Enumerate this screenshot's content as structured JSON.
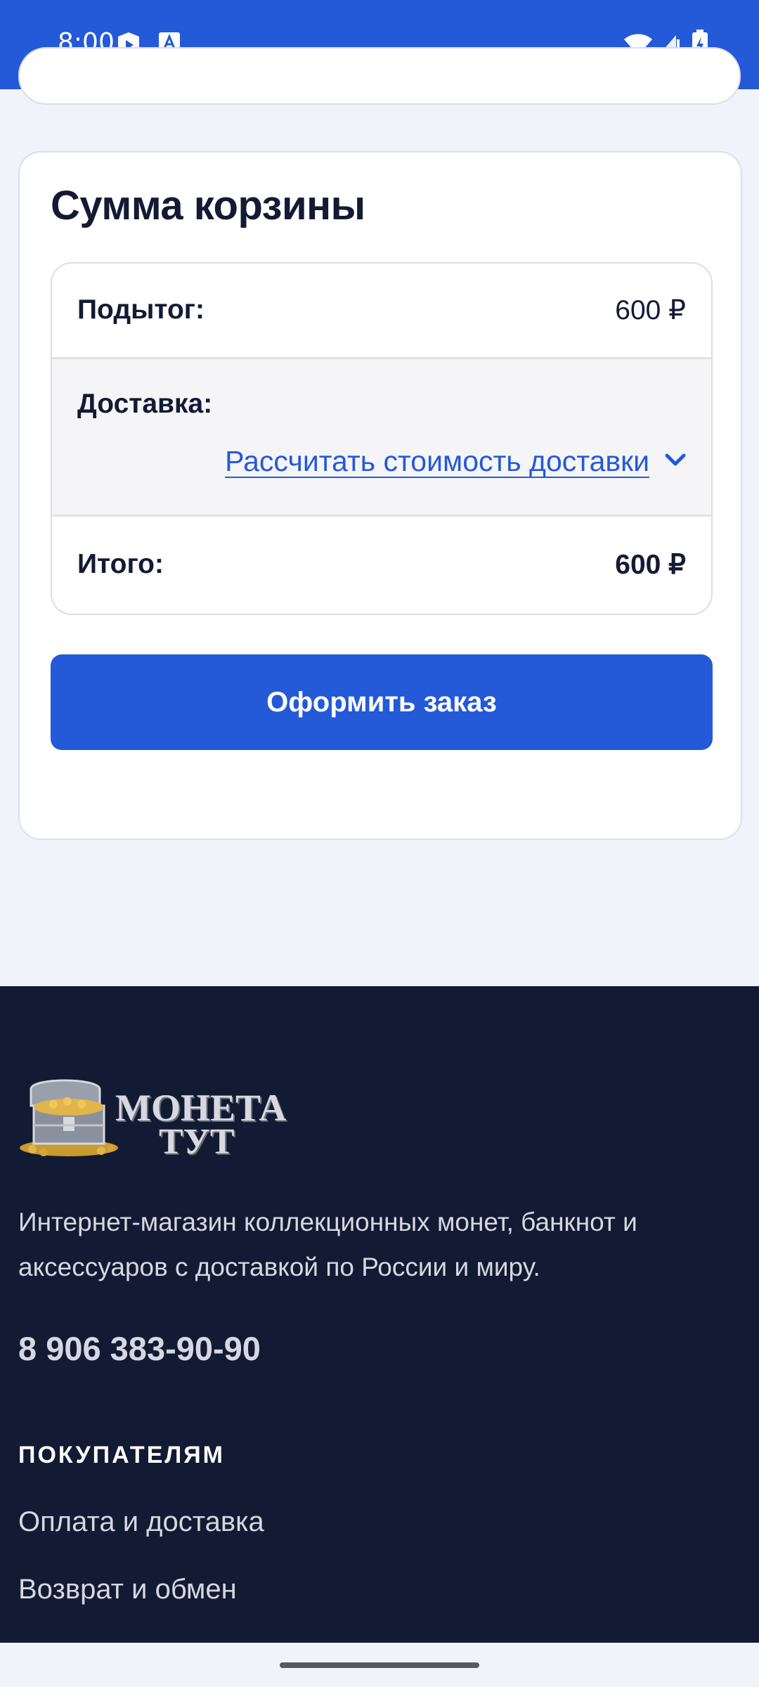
{
  "status_bar": {
    "time": "8:00"
  },
  "cart_totals": {
    "title": "Сумма корзины",
    "subtotal_label": "Подытог:",
    "subtotal_value": "600 ₽",
    "shipping_label": "Доставка:",
    "shipping_calc_link": "Рассчитать стоимость доставки",
    "total_label": "Итого:",
    "total_value": "600 ₽",
    "checkout_button": "Оформить заказ"
  },
  "footer": {
    "logo_line1": "МОНЕТА",
    "logo_line2": "ТУТ",
    "description": "Интернет-магазин коллекционных монет, банкнот и аксессуаров с доставкой по России и миру.",
    "phone": "8 906 383-90-90",
    "section_title": "ПОКУПАТЕЛЯМ",
    "links": [
      "Оплата и доставка",
      "Возврат и обмен"
    ]
  },
  "colors": {
    "accent": "#2459d8",
    "footer_bg": "#131a33",
    "page_bg": "#f1f3fb"
  },
  "icons": [
    "shield-icon",
    "a-keyboard-icon",
    "wifi-icon",
    "signal-icon",
    "battery-icon",
    "chevron-down-icon",
    "treasure-chest-icon"
  ]
}
